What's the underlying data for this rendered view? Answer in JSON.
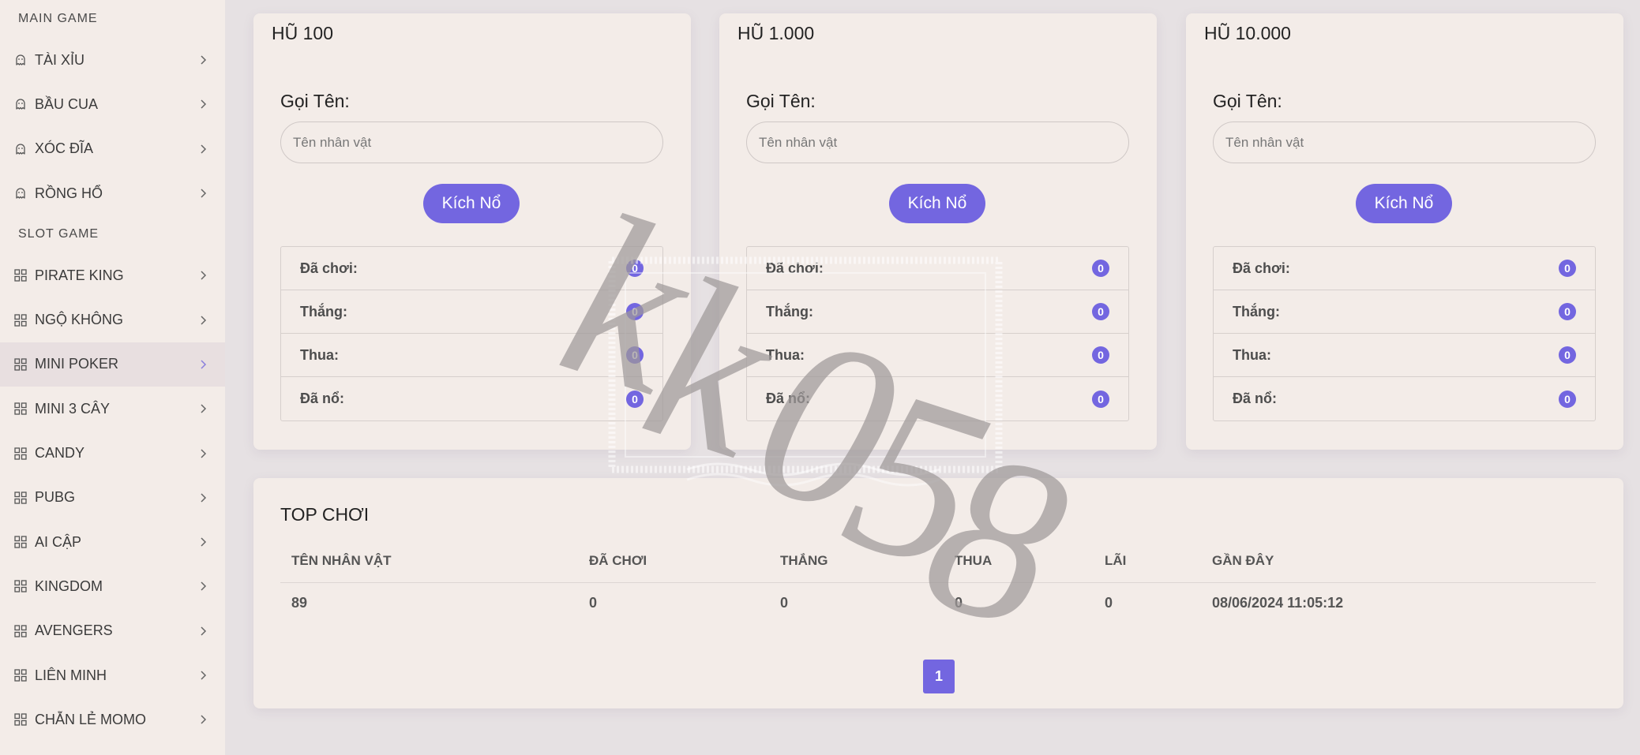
{
  "sidebar": {
    "sections": [
      {
        "title": "MAIN GAME",
        "items": [
          {
            "label": "TÀI XỈU",
            "icon": "ghost-icon"
          },
          {
            "label": "BẦU CUA",
            "icon": "ghost-icon"
          },
          {
            "label": "XÓC ĐĨA",
            "icon": "ghost-icon"
          },
          {
            "label": "RỒNG HỔ",
            "icon": "ghost-icon"
          }
        ]
      },
      {
        "title": "SLOT GAME",
        "items": [
          {
            "label": "PIRATE KING",
            "icon": "grid-icon"
          },
          {
            "label": "NGỘ KHÔNG",
            "icon": "grid-icon"
          },
          {
            "label": "MINI POKER",
            "icon": "grid-icon",
            "active": true
          },
          {
            "label": "MINI 3 CÂY",
            "icon": "grid-icon"
          },
          {
            "label": "CANDY",
            "icon": "grid-icon"
          },
          {
            "label": "PUBG",
            "icon": "grid-icon"
          },
          {
            "label": "AI CẬP",
            "icon": "grid-icon"
          },
          {
            "label": "KINGDOM",
            "icon": "grid-icon"
          },
          {
            "label": "AVENGERS",
            "icon": "grid-icon"
          },
          {
            "label": "LIÊN MINH",
            "icon": "grid-icon"
          },
          {
            "label": "CHẴN LẺ MOMO",
            "icon": "grid-icon"
          }
        ]
      }
    ]
  },
  "jackpots": [
    {
      "title": "HŨ 100",
      "name_label": "Gọi Tên:",
      "name_placeholder": "Tên nhân vật",
      "button_label": "Kích Nổ",
      "stats": [
        {
          "label": "Đã chơi:",
          "value": "0"
        },
        {
          "label": "Thắng:",
          "value": "0"
        },
        {
          "label": "Thua:",
          "value": "0"
        },
        {
          "label": "Đã nổ:",
          "value": "0"
        }
      ]
    },
    {
      "title": "HŨ 1.000",
      "name_label": "Gọi Tên:",
      "name_placeholder": "Tên nhân vật",
      "button_label": "Kích Nổ",
      "stats": [
        {
          "label": "Đã chơi:",
          "value": "0"
        },
        {
          "label": "Thắng:",
          "value": "0"
        },
        {
          "label": "Thua:",
          "value": "0"
        },
        {
          "label": "Đã nổ:",
          "value": "0"
        }
      ]
    },
    {
      "title": "HŨ 10.000",
      "name_label": "Gọi Tên:",
      "name_placeholder": "Tên nhân vật",
      "button_label": "Kích Nổ",
      "stats": [
        {
          "label": "Đã chơi:",
          "value": "0"
        },
        {
          "label": "Thắng:",
          "value": "0"
        },
        {
          "label": "Thua:",
          "value": "0"
        },
        {
          "label": "Đã nổ:",
          "value": "0"
        }
      ]
    }
  ],
  "top": {
    "title": "TOP CHƠI",
    "columns": [
      "TÊN NHÂN VẬT",
      "ĐÃ CHƠI",
      "THẮNG",
      "THUA",
      "LÃI",
      "GẦN ĐÂY"
    ],
    "rows": [
      [
        "89",
        "0",
        "0",
        "0",
        "0",
        "08/06/2024 11:05:12"
      ]
    ],
    "pagination": [
      "1"
    ]
  },
  "watermark": {
    "text": "kk058"
  },
  "colors": {
    "accent": "#7366e0",
    "background": "#e6e1e3",
    "panel": "#f3ece8",
    "sidebar_active": "#e8dfe0"
  }
}
